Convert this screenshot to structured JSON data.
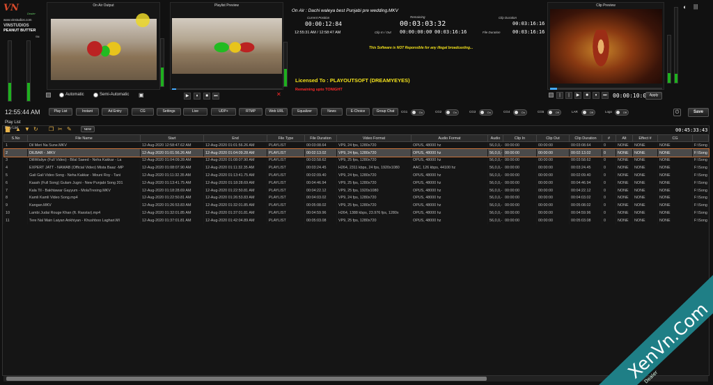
{
  "brand": {
    "logo_text": "VN",
    "logo_sub": "Dealer",
    "site": "www.vinstudios.com",
    "name": "VINSTUDIOS",
    "product": "PEANUT BUTTER",
    "edition": "SN"
  },
  "on_air_output": {
    "title": "On Air Output",
    "mode_automatic": "Automatic",
    "mode_semi": "Semi-Automatic",
    "selected_mode": "Automatic"
  },
  "playlist_preview": {
    "title": "Playlist Preview"
  },
  "center": {
    "on_air_label": "On Air : Dachi waleya best Punjabi pre wedding.MKV",
    "current_position_label": "Current Position",
    "current_position": "00:00:12:84",
    "remaining_label": "Remaining",
    "remaining": "00:03:03:32",
    "clip_duration_label": "Clip Duration",
    "clip_duration": "00:03:16:16",
    "clock_range": "12:55:31 AM / 12:58:47 AM",
    "clip_in_out_label": "Clip In / Out",
    "clip_in": "00:00:00:00",
    "clip_out": "00:03:16:16",
    "file_duration_label": "File Duration",
    "file_duration": "00:03:16:16",
    "disclaimer": "This Software is NOT Reponsible for any illegal broadcasting...",
    "licensed_to": "Licensed To : PLAYOUTSOFT (DREAMYEYES)",
    "remaining_upto": "Remaining upto TONIGHT"
  },
  "clip_preview": {
    "title": "Clip Preview",
    "timecode": "00:00:10:08",
    "apply_label": "Apply"
  },
  "toolbar": {
    "clock": "12:55:44 AM",
    "buttons": [
      "Play List",
      "Instant",
      "Ad Entry",
      "CG",
      "Settings",
      "Live",
      "UDP+",
      "RTMP",
      "Web URL",
      "Equalizer",
      "News",
      "E-Choice",
      "Group Chat"
    ],
    "toggles": [
      {
        "label": "CG1",
        "state": "On"
      },
      {
        "label": "CG2",
        "state": "On"
      },
      {
        "label": "CG3",
        "state": "On"
      },
      {
        "label": "CG4",
        "state": "On"
      },
      {
        "label": "CG5",
        "state": "Off"
      },
      {
        "label": "LAR",
        "state": "Off"
      },
      {
        "label": "Logo",
        "state": "Off"
      }
    ],
    "save_label": "Save"
  },
  "playlist": {
    "section_title": "Play List",
    "inner_title": "Play List",
    "new_label": "NEW",
    "total_duration": "00:45:33:43",
    "columns": [
      "S.No",
      "File Name",
      "Start",
      "End",
      "File Type",
      "File Duration",
      "Video Format",
      "Audio Format",
      "Audio",
      "Clip In",
      "Clip Out",
      "Clip Duration",
      "#",
      "Alt",
      "Effect #",
      "CG",
      ""
    ],
    "rows": [
      [
        "1",
        "Dil Meri Na Sune.MKV",
        "12-Aug-2020 12:58:47.62 AM",
        "12-Aug-2020 01:01:56.26 AM",
        "PLAYLIST",
        "00:03:08.64",
        "VP9, 24 fps, 1280x720",
        "OPUS, 48000 hz",
        "56,0,0,-",
        "00:00:00",
        "00:00:00",
        "00:03:08.64",
        "0",
        "NONE",
        "NONE",
        "NONE",
        "F:\\Song"
      ],
      [
        "2",
        "DILBAR - .MKV",
        "12-Aug-2020 01:01:56.26 AM",
        "12-Aug-2020 01:04:09.28 AM",
        "PLAYLIST",
        "00:02:13.02",
        "VP9, 24 fps, 1280x720",
        "OPUS, 48000 hz",
        "56,0,0,-",
        "00:00:00",
        "00:00:00",
        "00:02:13.02",
        "0",
        "NONE",
        "NONE",
        "NONE",
        "F:\\Song"
      ],
      [
        "3",
        "DilliWaliye (Full Video) - Bilal Saeed - Neha Kakkar - La",
        "12-Aug-2020 01:04:09.28 AM",
        "12-Aug-2020 01:08:07.90 AM",
        "PLAYLIST",
        "00:03:58.62",
        "VP9, 25 fps, 1280x720",
        "OPUS, 48000 hz",
        "56,0,0,-",
        "00:00:00",
        "00:00:00",
        "00:03:58.62",
        "0",
        "NONE",
        "NONE",
        "NONE",
        "F:\\Song"
      ],
      [
        "4",
        "EXPERT JATT - NAWAB (Official Video) Mista Baaz -MP",
        "12-Aug-2020 01:08:07.90 AM",
        "12-Aug-2020 01:11:32.35 AM",
        "PLAYLIST",
        "00:03:24.45",
        "H264, 2311 kbps, 24 fps, 1920x1080",
        "AAC, 126 kbps, 44100 hz",
        "56,0,0,-",
        "00:00:00",
        "00:00:00",
        "00:03:24.45",
        "0",
        "NONE",
        "NONE",
        "NONE",
        "F:\\Song"
      ],
      [
        "5",
        "Gali Gali Video Song - Neha Kakkar - Mouni Roy - Tani",
        "12-Aug-2020 01:11:32.35 AM",
        "12-Aug-2020 01:13:41.75 AM",
        "PLAYLIST",
        "00:02:09.40",
        "VP9, 24 fps, 1280x720",
        "OPUS, 48000 hz",
        "56,0,0,-",
        "00:00:00",
        "00:00:00",
        "00:02:09.40",
        "0",
        "NONE",
        "NONE",
        "NONE",
        "F:\\Song"
      ],
      [
        "6",
        "Kaash (Full Song) Gulam Jugni - New Punjabi Song 201",
        "12-Aug-2020 01:13:41.75 AM",
        "12-Aug-2020 01:18:28.69 AM",
        "PLAYLIST",
        "00:04:46.94",
        "VP9, 25 fps, 1280x720",
        "OPUS, 48000 hz",
        "56,0,0,-",
        "00:00:00",
        "00:00:00",
        "00:04:46.94",
        "0",
        "NONE",
        "NONE",
        "NONE",
        "F:\\Song"
      ],
      [
        "7",
        "Kala Til - Bakhtawar Gayyum - MolaTrexing.MKV",
        "12-Aug-2020 01:18:28.69 AM",
        "12-Aug-2020 01:22:50.81 AM",
        "PLAYLIST",
        "00:04:22.12",
        "VP9, 25 fps, 1920x1080",
        "OPUS, 48000 hz",
        "56,0,0,-",
        "00:00:00",
        "00:00:00",
        "00:04:22.12",
        "0",
        "NONE",
        "NONE",
        "NONE",
        "F:\\Song"
      ],
      [
        "8",
        "Kamli Kamli Video Song.mp4",
        "12-Aug-2020 01:22:50.81 AM",
        "12-Aug-2020 01:26:53.83 AM",
        "PLAYLIST",
        "00:04:03.02",
        "VP9, 24 fps, 1280x720",
        "OPUS, 48000 hz",
        "56,0,0,-",
        "00:00:00",
        "00:00:00",
        "00:04:03.02",
        "0",
        "NONE",
        "NONE",
        "NONE",
        "F:\\Song"
      ],
      [
        "9",
        "Kangan.MKV",
        "12-Aug-2020 01:26:53.83 AM",
        "12-Aug-2020 01:32:01.85 AM",
        "PLAYLIST",
        "00:05:08.02",
        "VP9, 25 fps, 1280x720",
        "OPUS, 48000 hz",
        "56,0,0,-",
        "00:00:00",
        "00:00:00",
        "00:05:08.02",
        "0",
        "NONE",
        "NONE",
        "NONE",
        "F:\\Song"
      ],
      [
        "10",
        "Lambi Judai   Rouge Khan (ft. Raxstar).mp4",
        "12-Aug-2020 01:32:01.85 AM",
        "12-Aug-2020 01:37:01.81 AM",
        "PLAYLIST",
        "00:04:59.96",
        "H264, 1388 kbps, 23.976 fps, 1280x",
        "OPUS, 48000 hz",
        "56,0,0,-",
        "00:00:00",
        "00:00:00",
        "00:04:59.96",
        "0",
        "NONE",
        "NONE",
        "NONE",
        "F:\\Song"
      ],
      [
        "11",
        "Tere Nal Main Laiyan Ankhiyan - Khushboo Laghari.MI",
        "12-Aug-2020 01:37:01.81 AM",
        "12-Aug-2020 01:42:04.89 AM",
        "PLAYLIST",
        "00:05:03.08",
        "VP9, 25 fps, 1280x720",
        "OPUS, 48000 hz",
        "56,0,0,-",
        "00:00:00",
        "00:00:00",
        "00:05:03.08",
        "0",
        "NONE",
        "NONE",
        "NONE",
        "F:\\Song"
      ]
    ]
  },
  "watermark": {
    "text": "XenVn.Com",
    "sub": "Dealer"
  },
  "colors": {
    "accent_orange": "#c9733b",
    "timer_yellow": "#e7d24a",
    "license_yellow": "#f2e11c",
    "alert_red": "#ff2a2a",
    "vu_green": "#17b317",
    "watermark_teal": "#1f7f86"
  }
}
